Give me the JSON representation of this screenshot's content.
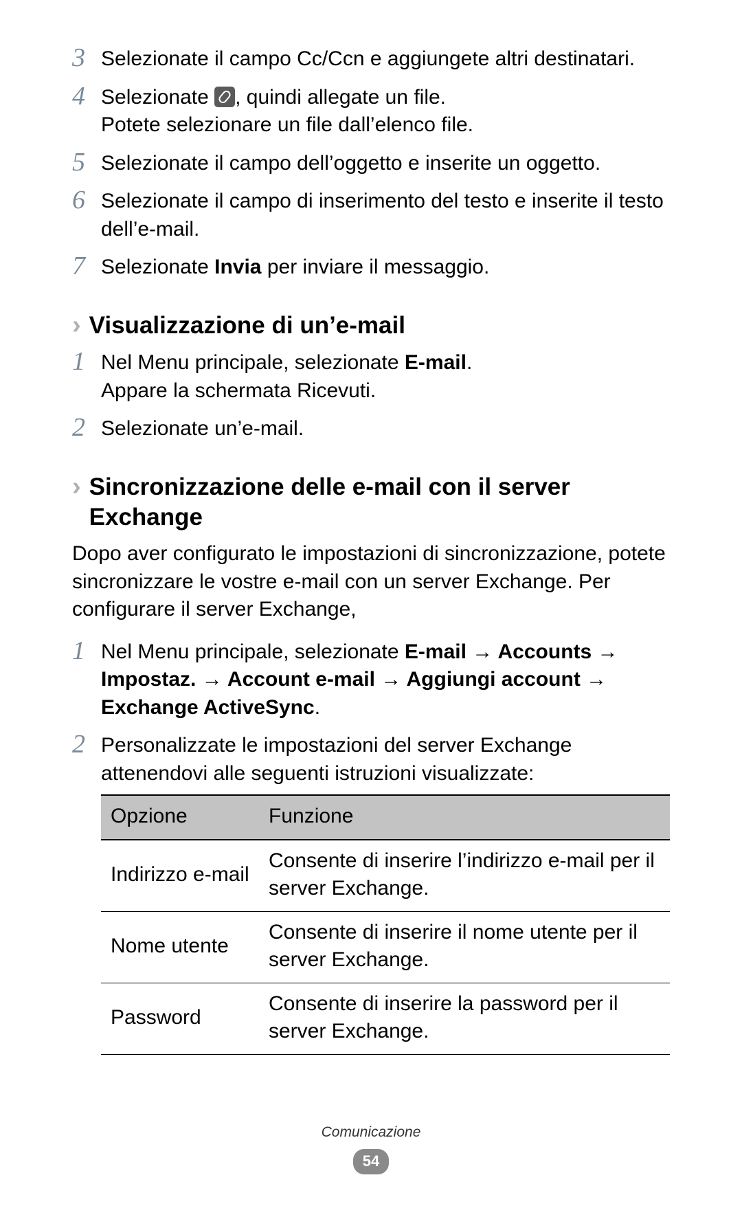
{
  "steps_a": [
    {
      "num": "3",
      "text": "Selezionate il campo Cc/Ccn e aggiungete altri destinatari."
    },
    {
      "num": "4",
      "pre": "Selezionate ",
      "icon": "attach-icon",
      "post": ", quindi allegate un file.",
      "line2": "Potete selezionare un file dall’elenco file."
    },
    {
      "num": "5",
      "text": "Selezionate il campo dell’oggetto e inserite un oggetto."
    },
    {
      "num": "6",
      "text": "Selezionate il campo di inserimento del testo e inserite il testo dell’e-mail."
    },
    {
      "num": "7",
      "pre": "Selezionate ",
      "bold": "Invia",
      "post": " per inviare il messaggio."
    }
  ],
  "section_b": {
    "heading": "Visualizzazione di un’e-mail",
    "steps": [
      {
        "num": "1",
        "pre": "Nel Menu principale, selezionate ",
        "bold": "E-mail",
        "post": ".",
        "line2": "Appare la schermata Ricevuti."
      },
      {
        "num": "2",
        "text": "Selezionate un’e-mail."
      }
    ]
  },
  "section_c": {
    "heading": "Sincronizzazione delle e-mail con il server Exchange",
    "intro": "Dopo aver configurato le impostazioni di sincronizzazione, potete sincronizzare le vostre e-mail con un server Exchange. Per configurare il server Exchange,",
    "step1": {
      "num": "1",
      "pre": "Nel Menu principale, selezionate ",
      "bold_path": "E-mail → Accounts → Impostaz. → Account e-mail → Aggiungi account → Exchange ActiveSync",
      "post": "."
    },
    "step2": {
      "num": "2",
      "text": "Personalizzate le impostazioni del server Exchange attenendovi alle seguenti istruzioni visualizzate:"
    },
    "table": {
      "headers": {
        "c1": "Opzione",
        "c2": "Funzione"
      },
      "rows": [
        {
          "c1": "Indirizzo e-mail",
          "c2": "Consente di inserire l’indirizzo e-mail per il server Exchange."
        },
        {
          "c1": "Nome utente",
          "c2": "Consente di inserire il nome utente per il server Exchange."
        },
        {
          "c1": "Password",
          "c2": "Consente di inserire la password per il server Exchange."
        }
      ]
    }
  },
  "footer": {
    "section": "Comunicazione",
    "page": "54"
  }
}
